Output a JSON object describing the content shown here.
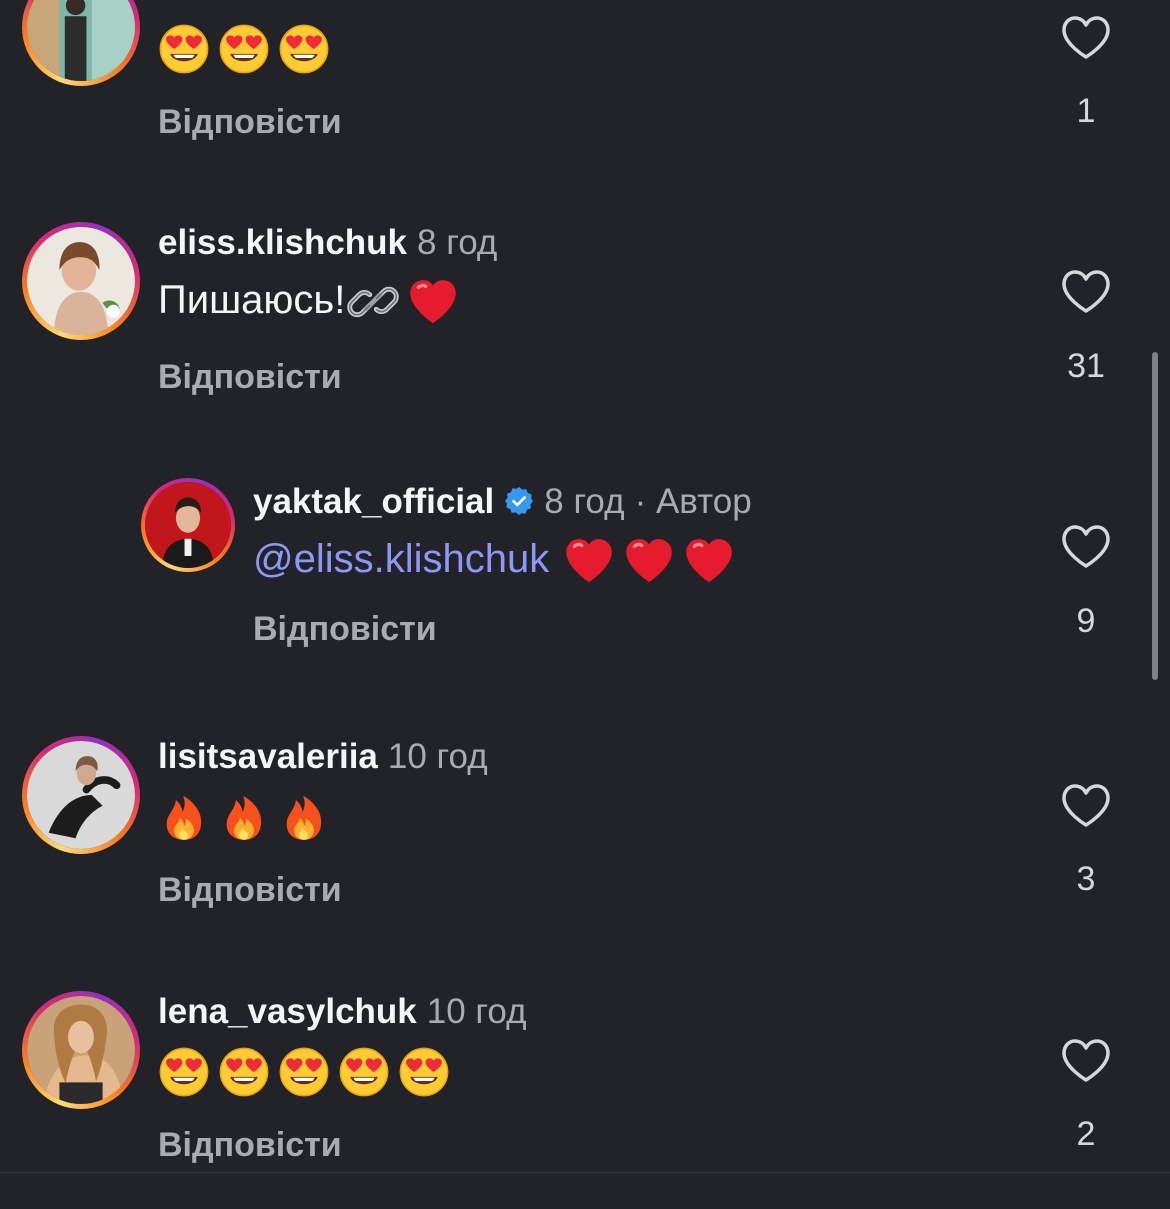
{
  "reply_label": "Відповісти",
  "colors": {
    "background": "#212328",
    "username": "#f3f5f7",
    "secondary_text": "#a8abb2",
    "mention": "#8e97f5",
    "verified": "#3897f0"
  },
  "comments": [
    {
      "username": "",
      "time": "",
      "body_text": "",
      "emojis": [
        "heart-eyes",
        "heart-eyes",
        "heart-eyes"
      ],
      "likes": "1",
      "reply_label": "Відповісти"
    },
    {
      "username": "eliss.klishchuk",
      "time": "8 год",
      "body_text": "Пишаюсь!",
      "emojis": [
        "link",
        "red-heart"
      ],
      "likes": "31",
      "reply_label": "Відповісти"
    },
    {
      "username": "yaktak_official",
      "verified": true,
      "time": "8 год",
      "author_label": "· Автор",
      "mention": "@eliss.klishchuk",
      "emojis": [
        "red-heart",
        "red-heart",
        "red-heart"
      ],
      "likes": "9",
      "reply_label": "Відповісти"
    },
    {
      "username": "lisitsavaleriia",
      "time": "10 год",
      "body_text": "",
      "emojis": [
        "fire",
        "fire",
        "fire"
      ],
      "likes": "3",
      "reply_label": "Відповісти"
    },
    {
      "username": "lena_vasylchuk",
      "time": "10 год",
      "body_text": "",
      "emojis": [
        "heart-eyes",
        "heart-eyes",
        "heart-eyes",
        "heart-eyes",
        "heart-eyes"
      ],
      "likes": "2",
      "reply_label": "Відповісти"
    }
  ]
}
